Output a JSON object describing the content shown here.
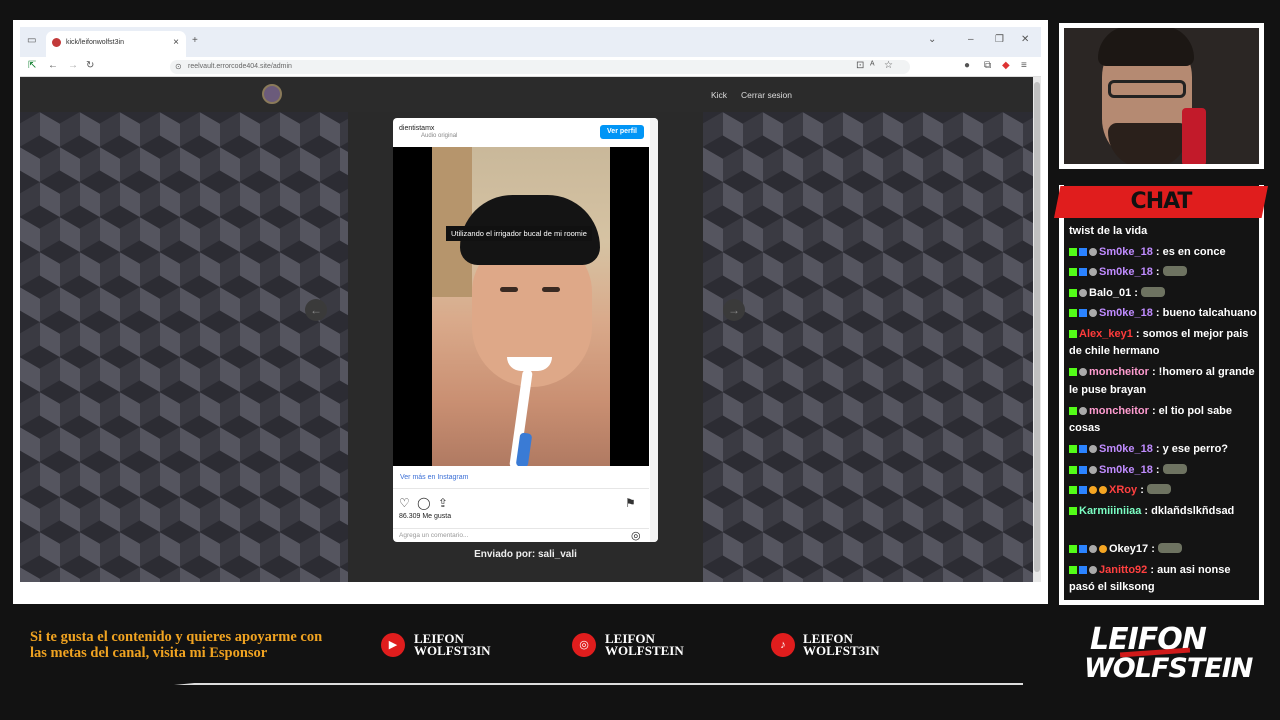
{
  "browser": {
    "tab_title": "kick/leifonwolfst3in",
    "url": "reelvault.errorcode404.site/admin"
  },
  "site": {
    "nav": {
      "kick": "Kick",
      "logout": "Cerrar sesion"
    }
  },
  "post": {
    "username": "dientistamx",
    "audio": "Audio original",
    "profile_button": "Ver perfil",
    "caption": "Utilizando el irrigador bucal de mi roomie",
    "see_more": "Ver más en Instagram",
    "likes": "86.309 Me gusta",
    "comment_placeholder": "Agrega un comentario...",
    "sent_by": "Enviado por: sali_vali"
  },
  "chat": {
    "title": "CHAT",
    "messages": [
      {
        "user": "",
        "color": "#ffffff",
        "text": "twist de la vida",
        "badges": []
      },
      {
        "user": "Sm0ke_18",
        "color": "#c08cff",
        "text": ": es en conce",
        "badges": [
          "k",
          "b",
          "s"
        ]
      },
      {
        "user": "Sm0ke_18",
        "color": "#c08cff",
        "text": ":",
        "badges": [
          "k",
          "b",
          "s"
        ],
        "emote": true
      },
      {
        "user": "Balo_01",
        "color": "#ffffff",
        "text": ":",
        "badges": [
          "k",
          "s"
        ],
        "emote": true
      },
      {
        "user": "Sm0ke_18",
        "color": "#c08cff",
        "text": ": bueno talcahuano",
        "badges": [
          "k",
          "b",
          "s"
        ]
      },
      {
        "user": "Alex_key1",
        "color": "#ff3b3b",
        "text": ": somos el mejor pais de chile hermano",
        "badges": [
          "k"
        ]
      },
      {
        "user": "moncheitor",
        "color": "#ff9cd0",
        "text": ": !homero al grande le puse brayan",
        "badges": [
          "k",
          "s"
        ]
      },
      {
        "user": "moncheitor",
        "color": "#ff9cd0",
        "text": ": el tio pol sabe cosas",
        "badges": [
          "k",
          "s"
        ]
      },
      {
        "user": "Sm0ke_18",
        "color": "#c08cff",
        "text": ": y ese perro?",
        "badges": [
          "k",
          "b",
          "s"
        ]
      },
      {
        "user": "Sm0ke_18",
        "color": "#c08cff",
        "text": ":",
        "badges": [
          "k",
          "b",
          "s"
        ],
        "emote": true
      },
      {
        "user": "XRoy",
        "color": "#ff4040",
        "text": ":",
        "badges": [
          "k",
          "b",
          "o",
          "o"
        ],
        "emote": true
      },
      {
        "user": "Karmiiiniiaa",
        "color": "#7cffc4",
        "text": ": dklañdslkñdsad",
        "badges": [
          "k"
        ]
      },
      {
        "user": "Okey17",
        "color": "#ffffff",
        "text": ":",
        "badges": [
          "k",
          "b",
          "s",
          "o"
        ],
        "emote": true
      },
      {
        "user": "Janitto92",
        "color": "#ff4040",
        "text": ": aun asi nonse pasó el silksong",
        "badges": [
          "k",
          "b",
          "s"
        ]
      }
    ]
  },
  "bottom": {
    "promo": "Si te gusta el contenido y quieres apoyarme con las metas del canal, visita mi Esponsor",
    "youtube_l1": "LEIFON",
    "youtube_l2": "WOLFST3IN",
    "instagram_l1": "LEIFON",
    "instagram_l2": "WOLFSTEIN",
    "tiktok_l1": "LEIFON",
    "tiktok_l2": "WOLFST3IN",
    "logo_l1": "LEIFON",
    "logo_l2": "WOLFSTEIN"
  },
  "colors": {
    "accent": "#e01d1d",
    "promo": "#f0a321",
    "kick_green": "#53fc18"
  }
}
